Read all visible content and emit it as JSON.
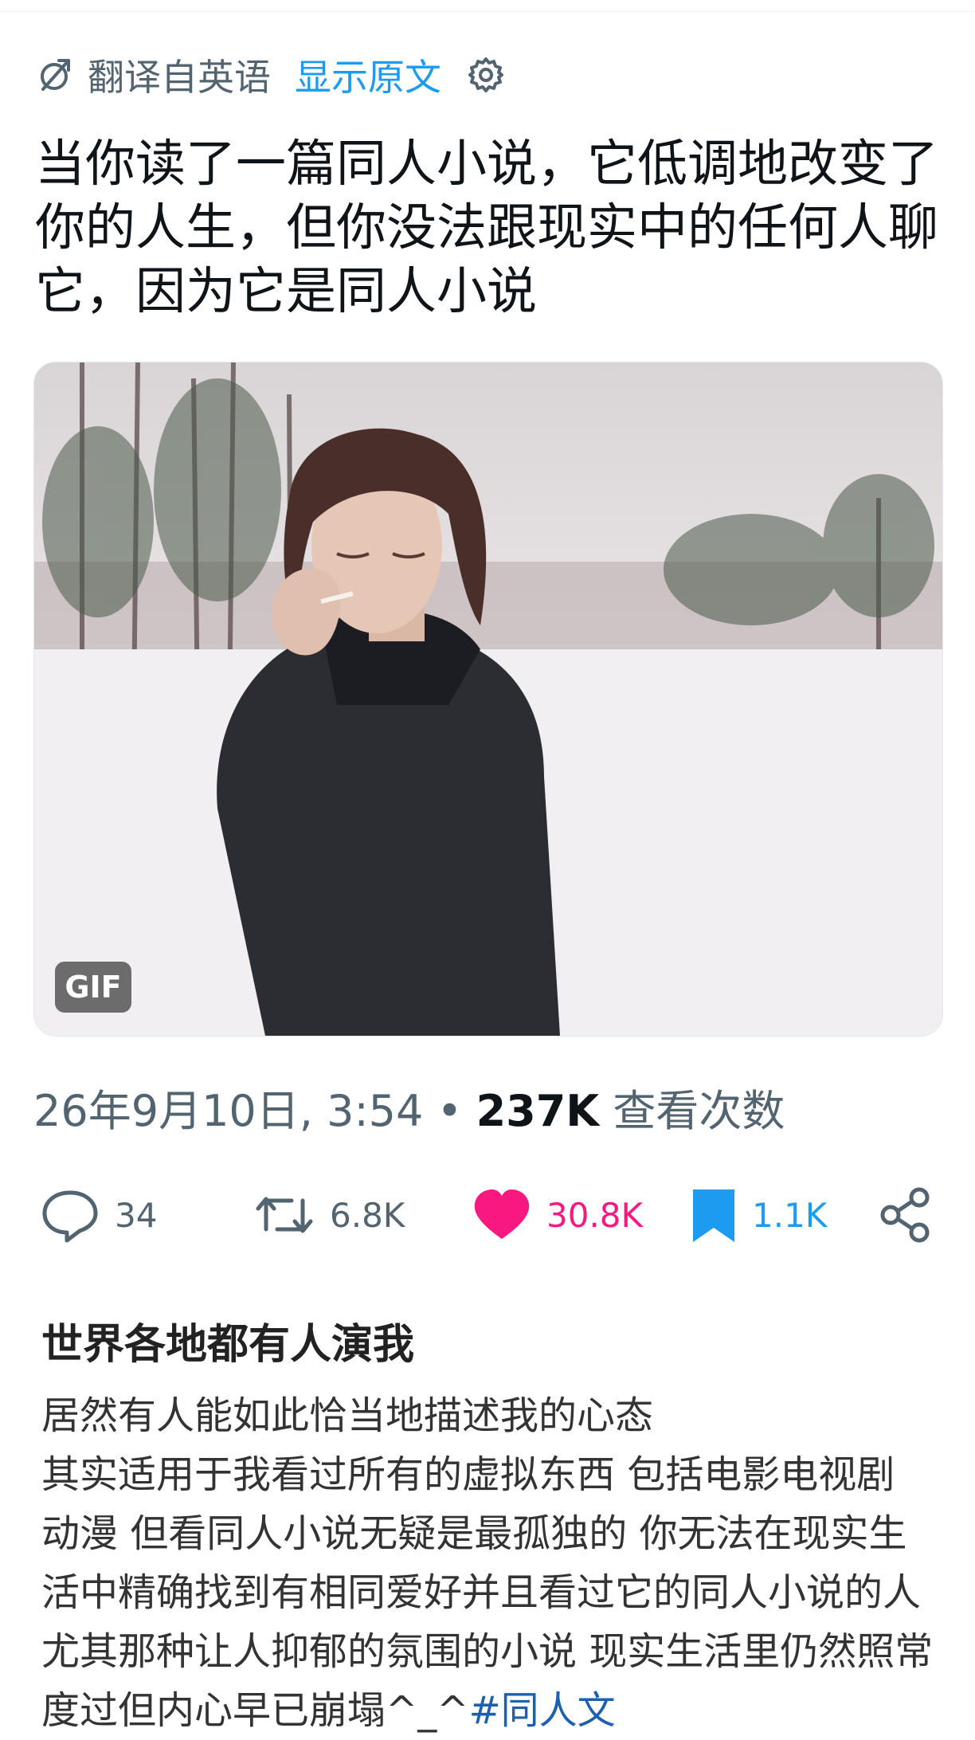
{
  "translation": {
    "label": "翻译自英语",
    "show_original": "显示原文"
  },
  "post": {
    "text": "当你读了一篇同人小说，它低调地改变了你的人生，但你没法跟现实中的任何人聊它，因为它是同人小说",
    "media": {
      "badge": "GIF"
    },
    "date": "26年9月10日, 3:54",
    "separator": "•",
    "views_count": "237K",
    "views_label": "查看次数"
  },
  "actions": {
    "reply_count": "34",
    "retweet_count": "6.8K",
    "like_count": "30.8K",
    "bookmark_count": "1.1K"
  },
  "colors": {
    "like": "#f91880",
    "bookmark": "#1d9bf0",
    "link": "#1d9bf0",
    "hashtag": "#1d5fb0",
    "muted": "#536471"
  },
  "comment": {
    "username": "世界各地都有人演我",
    "body": "居然有人能如此恰当地描述我的心态\n其实适用于我看过所有的虚拟东西 包括电影电视剧 动漫 但看同人小说无疑是最孤独的 你无法在现实生活中精确找到有相同爱好并且看过它的同人小说的人 尤其那种让人抑郁的氛围的小说 现实生活里仍然照常度过但内心早已崩塌^_^",
    "hashtag": "#同人文"
  }
}
